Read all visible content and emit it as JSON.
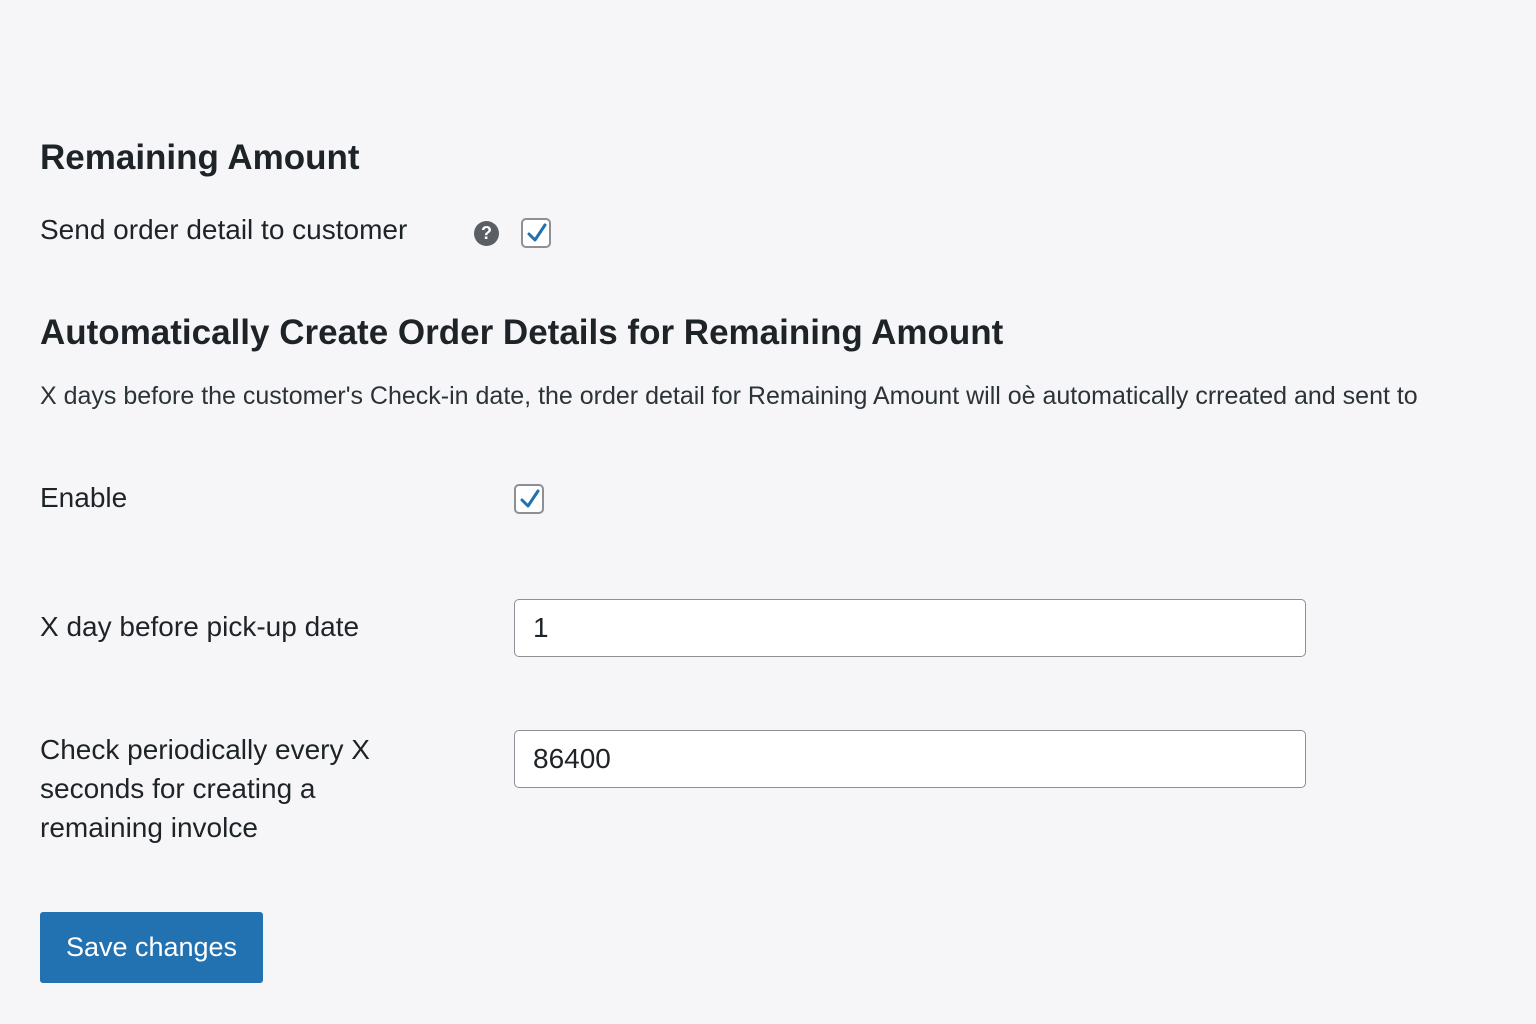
{
  "remaining_amount": {
    "title": "Remaining Amount",
    "send_order_detail": {
      "label": "Send order detail to customer",
      "help_icon": "?",
      "checked": true
    }
  },
  "auto_create": {
    "title": "Automatically Create Order Details for Remaining Amount",
    "description": "X days before the customer's Check-in date, the order detail for Remaining Amount will  oè automatically crreated and sent to",
    "enable": {
      "label": "Enable",
      "checked": true
    },
    "days_before": {
      "label": "X day before pick-up date",
      "value": "1"
    },
    "check_interval": {
      "label_line1": "Check periodically every X",
      "label_line2": "seconds for creating a",
      "label_line3": "remaining involce",
      "value": "86400"
    }
  },
  "actions": {
    "save_label": "Save changes"
  },
  "colors": {
    "accent": "#2271b1",
    "check": "#2271b1",
    "background": "#f6f6f8"
  },
  "icons": {
    "help": "help-icon",
    "checkmark": "checkmark-icon"
  }
}
